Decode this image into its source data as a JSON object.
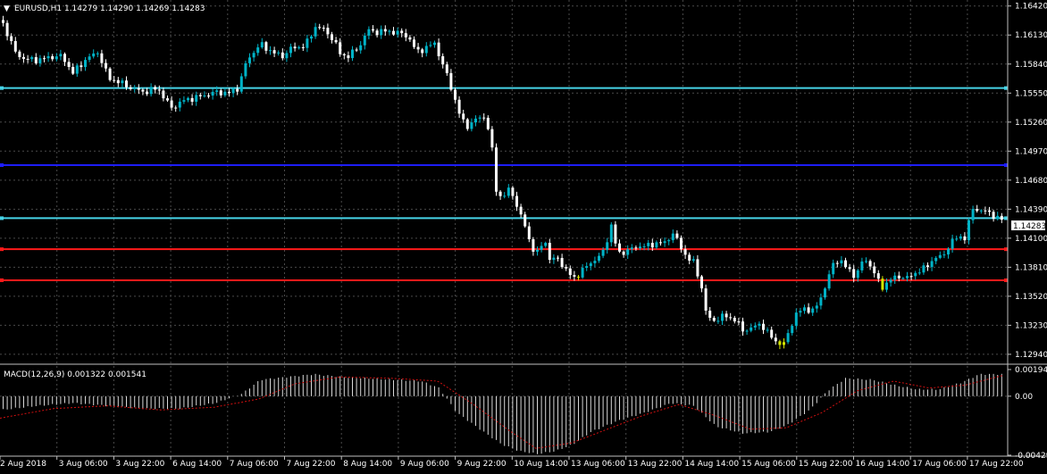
{
  "symbol_header": {
    "arrow": "▼",
    "text": "EURUSD,H1  1.14279 1.14290 1.14269 1.14283"
  },
  "macd_header": {
    "text": "MACD(12,26,9) 0.001322 0.001541"
  },
  "colors": {
    "background": "#000000",
    "grid": "#4a4a4a",
    "bull_candle": "#00b3c7",
    "bear_candle": "#ffffff",
    "highlight_candle": "#d4e600",
    "level_cyan": "#46d3e6",
    "level_blue": "#1d1dff",
    "level_red": "#ff1a1a",
    "macd_hist": "#d9d9d9",
    "macd_signal": "#d01010"
  },
  "current_price_tag": "1.14283",
  "chart_data": [
    {
      "type": "candlestick",
      "symbol": "EURUSD",
      "timeframe": "H1",
      "last_bar": {
        "open": 1.14279,
        "high": 1.1429,
        "low": 1.14269,
        "close": 1.14283
      },
      "y_ticks": [
        "1.16420",
        "1.16130",
        "1.15840",
        "1.15550",
        "1.15260",
        "1.14970",
        "1.14680",
        "1.14390",
        "1.14100",
        "1.13810",
        "1.13520",
        "1.13230",
        "1.12940"
      ],
      "ylim": [
        1.1285,
        1.1648
      ],
      "x_ticks": [
        "2 Aug 2018",
        "3 Aug 06:00",
        "3 Aug 22:00",
        "6 Aug 14:00",
        "7 Aug 06:00",
        "7 Aug 22:00",
        "8 Aug 14:00",
        "9 Aug 06:00",
        "9 Aug 22:00",
        "10 Aug 14:00",
        "13 Aug 06:00",
        "13 Aug 22:00",
        "14 Aug 14:00",
        "15 Aug 06:00",
        "15 Aug 22:00",
        "16 Aug 14:00",
        "17 Aug 06:00",
        "17 Aug 22:00"
      ],
      "horizontal_levels": [
        {
          "price": 1.156,
          "color": "cyan"
        },
        {
          "price": 1.1483,
          "color": "blue"
        },
        {
          "price": 1.143,
          "color": "cyan"
        },
        {
          "price": 1.1399,
          "color": "red"
        },
        {
          "price": 1.1368,
          "color": "red"
        }
      ],
      "close_path": [
        [
          0,
          1.1628
        ],
        [
          8,
          1.1612
        ],
        [
          16,
          1.1595
        ],
        [
          26,
          1.1589
        ],
        [
          40,
          1.1588
        ],
        [
          55,
          1.1591
        ],
        [
          68,
          1.1592
        ],
        [
          80,
          1.1575
        ],
        [
          95,
          1.1589
        ],
        [
          108,
          1.1596
        ],
        [
          120,
          1.157
        ],
        [
          132,
          1.1566
        ],
        [
          145,
          1.156
        ],
        [
          160,
          1.1556
        ],
        [
          175,
          1.156
        ],
        [
          190,
          1.154
        ],
        [
          205,
          1.1548
        ],
        [
          220,
          1.1551
        ],
        [
          240,
          1.1556
        ],
        [
          255,
          1.1555
        ],
        [
          265,
          1.156
        ],
        [
          275,
          1.1588
        ],
        [
          290,
          1.1604
        ],
        [
          305,
          1.1595
        ],
        [
          315,
          1.1592
        ],
        [
          325,
          1.16
        ],
        [
          340,
          1.1602
        ],
        [
          352,
          1.1622
        ],
        [
          362,
          1.1618
        ],
        [
          372,
          1.1608
        ],
        [
          380,
          1.1593
        ],
        [
          388,
          1.1592
        ],
        [
          400,
          1.16
        ],
        [
          410,
          1.1618
        ],
        [
          420,
          1.1616
        ],
        [
          432,
          1.1617
        ],
        [
          445,
          1.1615
        ],
        [
          455,
          1.1612
        ],
        [
          465,
          1.1596
        ],
        [
          475,
          1.16
        ],
        [
          485,
          1.1605
        ],
        [
          492,
          1.1588
        ],
        [
          500,
          1.157
        ],
        [
          508,
          1.1548
        ],
        [
          515,
          1.1528
        ],
        [
          522,
          1.1522
        ],
        [
          530,
          1.1528
        ],
        [
          540,
          1.1532
        ],
        [
          548,
          1.1512
        ],
        [
          553,
          1.146
        ],
        [
          560,
          1.145
        ],
        [
          570,
          1.146
        ],
        [
          578,
          1.144
        ],
        [
          587,
          1.142
        ],
        [
          594,
          1.14
        ],
        [
          600,
          1.1395
        ],
        [
          608,
          1.141
        ],
        [
          615,
          1.1385
        ],
        [
          622,
          1.1392
        ],
        [
          630,
          1.138
        ],
        [
          640,
          1.137
        ],
        [
          648,
          1.1375
        ],
        [
          658,
          1.1385
        ],
        [
          668,
          1.139
        ],
        [
          676,
          1.14
        ],
        [
          682,
          1.1425
        ],
        [
          690,
          1.1395
        ],
        [
          700,
          1.1397
        ],
        [
          712,
          1.1402
        ],
        [
          722,
          1.1402
        ],
        [
          732,
          1.1405
        ],
        [
          742,
          1.1405
        ],
        [
          752,
          1.1415
        ],
        [
          760,
          1.1402
        ],
        [
          768,
          1.139
        ],
        [
          776,
          1.1385
        ],
        [
          784,
          1.136
        ],
        [
          790,
          1.133
        ],
        [
          800,
          1.1328
        ],
        [
          810,
          1.1333
        ],
        [
          822,
          1.1328
        ],
        [
          830,
          1.1318
        ],
        [
          840,
          1.132
        ],
        [
          850,
          1.1325
        ],
        [
          858,
          1.1315
        ],
        [
          868,
          1.1306
        ],
        [
          876,
          1.1304
        ],
        [
          882,
          1.1318
        ],
        [
          890,
          1.1335
        ],
        [
          900,
          1.134
        ],
        [
          910,
          1.1337
        ],
        [
          920,
          1.1356
        ],
        [
          930,
          1.1382
        ],
        [
          938,
          1.139
        ],
        [
          946,
          1.138
        ],
        [
          956,
          1.1372
        ],
        [
          966,
          1.139
        ],
        [
          975,
          1.138
        ],
        [
          985,
          1.136
        ],
        [
          994,
          1.1368
        ],
        [
          1004,
          1.1372
        ],
        [
          1014,
          1.137
        ],
        [
          1024,
          1.1376
        ],
        [
          1034,
          1.138
        ],
        [
          1044,
          1.139
        ],
        [
          1054,
          1.1392
        ],
        [
          1062,
          1.1405
        ],
        [
          1072,
          1.1412
        ],
        [
          1080,
          1.141
        ],
        [
          1086,
          1.144
        ],
        [
          1095,
          1.1438
        ],
        [
          1105,
          1.1436
        ],
        [
          1115,
          1.143
        ],
        [
          1122,
          1.1428
        ]
      ],
      "highlighted_bars": [
        645,
        647,
        986,
        988,
        872,
        874,
        876
      ]
    },
    {
      "type": "bar",
      "name": "MACD(12,26,9)",
      "values_text": "0.001322 0.001541",
      "y_ticks": [
        "0.001942",
        "0.00",
        "-0.004296"
      ],
      "ylim": [
        -0.0043,
        0.0022
      ],
      "histogram_path": [
        [
          0,
          -0.001
        ],
        [
          40,
          -0.0007
        ],
        [
          80,
          -0.0005
        ],
        [
          120,
          -0.0007
        ],
        [
          160,
          -0.0009
        ],
        [
          200,
          -0.0009
        ],
        [
          240,
          -0.0005
        ],
        [
          270,
          0.0002
        ],
        [
          290,
          0.0012
        ],
        [
          320,
          0.0014
        ],
        [
          350,
          0.0016
        ],
        [
          380,
          0.0014
        ],
        [
          410,
          0.0013
        ],
        [
          440,
          0.0012
        ],
        [
          470,
          0.0011
        ],
        [
          490,
          0.0006
        ],
        [
          510,
          -0.0012
        ],
        [
          540,
          -0.0026
        ],
        [
          560,
          -0.0035
        ],
        [
          580,
          -0.004
        ],
        [
          600,
          -0.0042
        ],
        [
          620,
          -0.004
        ],
        [
          640,
          -0.0035
        ],
        [
          660,
          -0.0026
        ],
        [
          690,
          -0.0018
        ],
        [
          720,
          -0.0012
        ],
        [
          750,
          -0.0005
        ],
        [
          775,
          -0.0007
        ],
        [
          800,
          -0.0022
        ],
        [
          830,
          -0.0027
        ],
        [
          860,
          -0.0026
        ],
        [
          880,
          -0.0021
        ],
        [
          905,
          -0.001
        ],
        [
          925,
          0.0004
        ],
        [
          945,
          0.0013
        ],
        [
          975,
          0.0012
        ],
        [
          1000,
          0.0008
        ],
        [
          1025,
          0.0005
        ],
        [
          1050,
          0.0005
        ],
        [
          1075,
          0.001
        ],
        [
          1095,
          0.0016
        ],
        [
          1122,
          0.0016
        ]
      ],
      "signal_path": [
        [
          0,
          -0.0016
        ],
        [
          60,
          -0.0009
        ],
        [
          120,
          -0.0007
        ],
        [
          180,
          -0.001
        ],
        [
          240,
          -0.0008
        ],
        [
          290,
          -0.0002
        ],
        [
          330,
          0.0009
        ],
        [
          380,
          0.0014
        ],
        [
          440,
          0.0013
        ],
        [
          490,
          0.0011
        ],
        [
          530,
          -0.0006
        ],
        [
          570,
          -0.0025
        ],
        [
          600,
          -0.0038
        ],
        [
          640,
          -0.0034
        ],
        [
          680,
          -0.0024
        ],
        [
          720,
          -0.0014
        ],
        [
          760,
          -0.0006
        ],
        [
          800,
          -0.0014
        ],
        [
          840,
          -0.0024
        ],
        [
          880,
          -0.0023
        ],
        [
          920,
          -0.0012
        ],
        [
          960,
          0.0004
        ],
        [
          1000,
          0.0011
        ],
        [
          1040,
          0.0006
        ],
        [
          1080,
          0.0008
        ],
        [
          1122,
          0.0015
        ]
      ]
    }
  ]
}
